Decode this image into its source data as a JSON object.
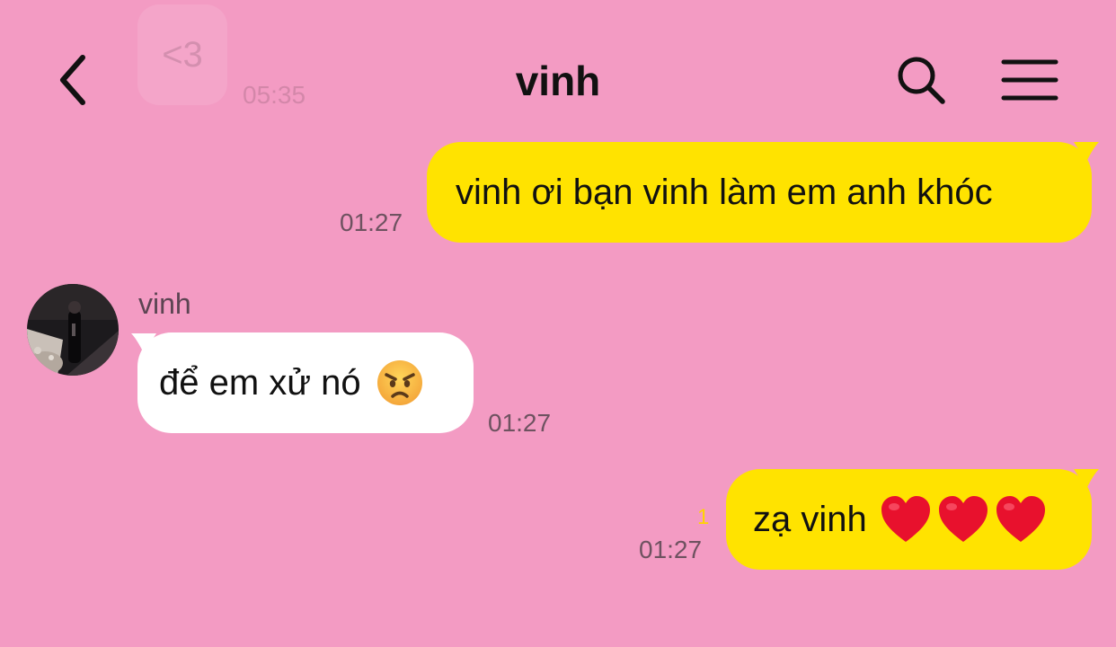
{
  "header": {
    "title": "vinh",
    "back_icon": "chevron-left-icon",
    "search_icon": "search-icon",
    "menu_icon": "hamburger-menu-icon"
  },
  "previous_message": {
    "text": "<3",
    "time": "05:35"
  },
  "messages": [
    {
      "direction": "outgoing",
      "text": "vinh ơi bạn vinh làm em anh khóc",
      "time": "01:27"
    },
    {
      "direction": "incoming",
      "sender": "vinh",
      "text": "để em xử nó",
      "emoji": "angry-face-emoji",
      "time": "01:27"
    },
    {
      "direction": "outgoing",
      "text": "zạ vinh",
      "emoji": "red-heart-emoji x3",
      "unread": "1",
      "time": "01:27"
    }
  ],
  "colors": {
    "background": "#F39BC3",
    "outgoing_bubble": "#FFE300",
    "incoming_bubble": "#FFFFFF",
    "unread_count": "#FFD400"
  }
}
